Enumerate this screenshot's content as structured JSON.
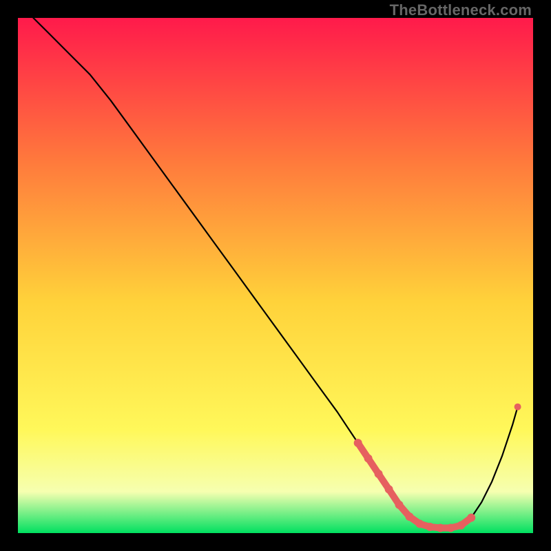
{
  "watermark": "TheBottleneck.com",
  "colors": {
    "gradient_top": "#ff1a4b",
    "gradient_mid_upper": "#ff7a3c",
    "gradient_mid": "#ffd23a",
    "gradient_mid_lower": "#fff85a",
    "gradient_lower": "#f6ffb0",
    "gradient_bottom": "#00e060",
    "curve": "#000000",
    "marker": "#e6605f",
    "frame": "#000000"
  },
  "chart_data": {
    "type": "line",
    "title": "",
    "xlabel": "",
    "ylabel": "",
    "xlim": [
      0,
      100
    ],
    "ylim": [
      0,
      100
    ],
    "series": [
      {
        "name": "bottleneck-curve",
        "x": [
          3,
          6,
          10,
          14,
          18,
          22,
          26,
          30,
          34,
          38,
          42,
          46,
          50,
          54,
          58,
          62,
          64,
          66,
          68,
          70,
          72,
          74,
          76,
          78,
          80,
          82,
          84,
          86,
          88,
          90,
          92,
          94,
          96,
          97
        ],
        "y": [
          100,
          97,
          93,
          89,
          84,
          78.5,
          73,
          67.5,
          62,
          56.5,
          51,
          45.5,
          40,
          34.5,
          29,
          23.5,
          20.5,
          17.5,
          14.5,
          11.5,
          8.5,
          5.5,
          3.2,
          1.8,
          1.2,
          1.0,
          1.0,
          1.5,
          3.0,
          6.0,
          10.0,
          15.0,
          21.0,
          24.5
        ]
      }
    ],
    "markers": {
      "name": "highlight-floor",
      "x": [
        66,
        68,
        70,
        72,
        74,
        76,
        78,
        80,
        82,
        84,
        86,
        88
      ],
      "y": [
        17.5,
        14.5,
        11.5,
        8.5,
        5.5,
        3.2,
        1.8,
        1.2,
        1.0,
        1.0,
        1.5,
        3.0
      ]
    },
    "markers_end": {
      "x": 97,
      "y": 24.5
    }
  }
}
